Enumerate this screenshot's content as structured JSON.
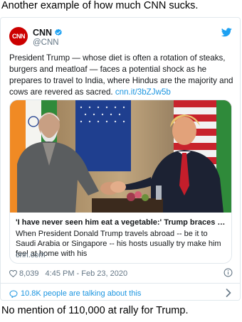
{
  "caption_top": "Another example of how much CNN sucks.",
  "caption_bottom": "No mention of 110,000 at rally for Trump.",
  "tweet": {
    "avatar_text": "CNN",
    "display_name": "CNN",
    "handle": "@CNN",
    "verified": true,
    "text": "President Trump — whose diet is often a rotation of steaks, burgers and meatloaf — faces a potential shock as he prepares to travel to India, where Hindus are the majority and cows are revered as sacred. ",
    "link": "cnn.it/3bZJw5b",
    "link_card": {
      "title": "'I have never seen him eat a vegetable:' Trump braces for a be...",
      "description": "When President Donald Trump travels abroad -- be it to Saudi Arabia or Singapore -- his hosts usually try make him feel at home with his",
      "domain": "cnn.com"
    },
    "likes": "8,039",
    "timestamp": "4:45 PM - Feb 23, 2020",
    "talking": "10.8K people are talking about this"
  },
  "colors": {
    "accent": "#1b95e0",
    "cnn_red": "#cc0000",
    "muted": "#657786",
    "border": "#e1e8ed"
  },
  "icons": [
    "verified-badge-icon",
    "twitter-bird-icon",
    "heart-icon",
    "info-icon",
    "speech-bubble-icon",
    "chevron-right-icon"
  ]
}
